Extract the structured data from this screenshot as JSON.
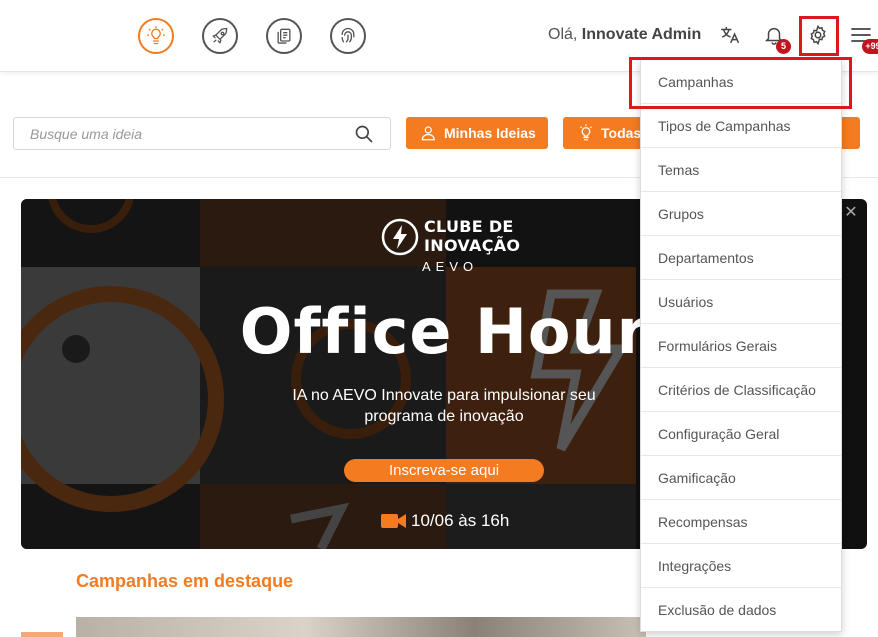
{
  "header": {
    "greeting_prefix": "Olá,",
    "user_name": "Innovate Admin",
    "notification_count": "5",
    "menu_badge": "+99",
    "nav_icons": [
      "lightbulb-icon",
      "rocket-icon",
      "documents-icon",
      "fingerprint-icon"
    ]
  },
  "toolbar": {
    "search_placeholder": "Busque uma ideia",
    "my_ideas_label": "Minhas Ideias",
    "all_label": "Todas"
  },
  "banner": {
    "logo_line1": "CLUBE DE",
    "logo_line2": "INOVAÇÃO",
    "logo_sub": "AEVO",
    "headline": "Office Hour",
    "subline1": "IA no AEVO Innovate para impulsionar seu",
    "subline2": "programa de inovação",
    "cta": "Inscreva-se aqui",
    "date": "10/06 às 16h",
    "close": "✕"
  },
  "section": {
    "title": "Campanhas em destaque"
  },
  "settings_menu": {
    "items": [
      "Campanhas",
      "Tipos de Campanhas",
      "Temas",
      "Grupos",
      "Departamentos",
      "Usuários",
      "Formulários Gerais",
      "Critérios de Classificação",
      "Configuração Geral",
      "Gamificação",
      "Recompensas",
      "Integrações",
      "Exclusão de dados"
    ]
  },
  "colors": {
    "accent": "#f47b20",
    "badge": "#c0151f",
    "highlight": "#e0161e"
  }
}
